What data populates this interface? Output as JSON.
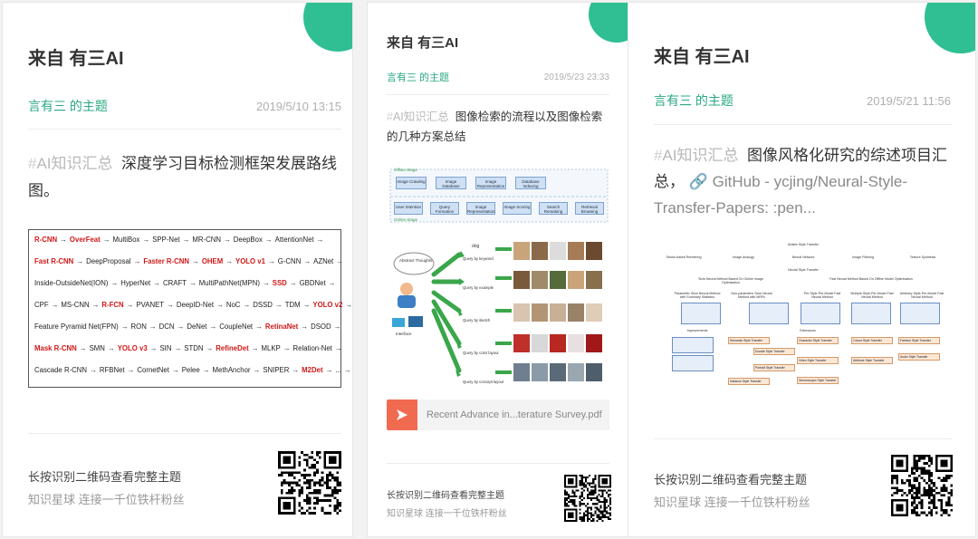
{
  "cards": [
    {
      "from": "来自 有三AI",
      "topic": "言有三 的主题",
      "time": "2019/5/10 13:15",
      "tag": "AI知识汇总",
      "text": "深度学习目标检测框架发展路线图。",
      "footer_line1": "长按识别二维码查看完整主题",
      "footer_line2": "知识星球  连接一千位铁杆粉丝"
    },
    {
      "from": "来自 有三AI",
      "topic": "言有三 的主题",
      "time": "2019/5/23 23:33",
      "tag": "AI知识汇总",
      "text": "图像检索的流程以及图像检索的几种方案总结",
      "attachment": "Recent Advance in...terature Survey.pdf",
      "footer_line1": "长按识别二维码查看完整主题",
      "footer_line2": "知识星球  连接一千位铁杆粉丝"
    },
    {
      "from": "来自 有三AI",
      "topic": "言有三 的主题",
      "time": "2019/5/21 11:56",
      "tag": "AI知识汇总",
      "text": "图像风格化研究的综述项目汇总，",
      "link_text": "GitHub - ycjing/Neural-Style-Transfer-Papers: :pen...",
      "footer_line1": "长按识别二维码查看完整主题",
      "footer_line2": "知识星球  连接一千位铁杆粉丝"
    }
  ],
  "detection_roadmap": {
    "rows": [
      [
        {
          "t": "R-CNN",
          "r": true
        },
        {
          "t": "OverFeat",
          "r": true
        },
        {
          "t": "MultiBox"
        },
        {
          "t": "SPP-Net"
        },
        {
          "t": "MR-CNN"
        },
        {
          "t": "DeepBox"
        },
        {
          "t": "AttentionNet"
        }
      ],
      [
        {
          "t": "Fast R-CNN",
          "r": true
        },
        {
          "t": "DeepProposal"
        },
        {
          "t": "Faster R-CNN",
          "r": true
        },
        {
          "t": "OHEM",
          "r": true
        },
        {
          "t": "YOLO v1",
          "r": true
        },
        {
          "t": "G-CNN"
        },
        {
          "t": "AZNet"
        }
      ],
      [
        {
          "t": "Inside-OutsideNet(ION)"
        },
        {
          "t": "HyperNet"
        },
        {
          "t": "CRAFT"
        },
        {
          "t": "MultiPathNet(MPN)"
        },
        {
          "t": "SSD",
          "r": true
        },
        {
          "t": "GBDNet"
        }
      ],
      [
        {
          "t": "CPF"
        },
        {
          "t": "MS-CNN"
        },
        {
          "t": "R-FCN",
          "r": true
        },
        {
          "t": "PVANET"
        },
        {
          "t": "DeepID-Net"
        },
        {
          "t": "NoC"
        },
        {
          "t": "DSSD"
        },
        {
          "t": "TDM"
        },
        {
          "t": "YOLO v2",
          "r": true
        }
      ],
      [
        {
          "t": "Feature Pyramid Net(FPN)"
        },
        {
          "t": "RON"
        },
        {
          "t": "DCN"
        },
        {
          "t": "DeNet"
        },
        {
          "t": "CoupleNet"
        },
        {
          "t": "RetinaNet",
          "r": true
        },
        {
          "t": "DSOD"
        }
      ],
      [
        {
          "t": "Mask R-CNN",
          "r": true
        },
        {
          "t": "SMN"
        },
        {
          "t": "YOLO v3",
          "r": true
        },
        {
          "t": "SIN"
        },
        {
          "t": "STDN"
        },
        {
          "t": "RefineDet",
          "r": true
        },
        {
          "t": "MLKP"
        },
        {
          "t": "Relation-Net"
        }
      ],
      [
        {
          "t": "Cascade R-CNN"
        },
        {
          "t": "RFBNet"
        },
        {
          "t": "CornetNet"
        },
        {
          "t": "Pelee"
        },
        {
          "t": "MethAnchor"
        },
        {
          "t": "SNIPER"
        },
        {
          "t": "M2Det",
          "r": true
        },
        {
          "t": "..."
        }
      ]
    ]
  },
  "retrieval_flow": {
    "offline_label": "Offline Stage",
    "online_label": "Online Stage",
    "offline_boxes": [
      "Image Crawling",
      "Image Database",
      "Image Representation",
      "Database Indexing"
    ],
    "online_boxes": [
      "User Intention",
      "Query Formation",
      "Image Representation",
      "Image Scoring",
      "Search Reranking",
      "Retrieval Browsing"
    ],
    "thought_label": "Abstract Thoughts",
    "interface_label": "Interface",
    "query_keyword_tag": "dog",
    "query_labels": [
      "Query by keyword",
      "Query by example",
      "Query by sketch",
      "Query by color layout",
      "Query by concept layout"
    ]
  },
  "style_tree": {
    "root": "Artistic Style Transfer",
    "top_categories": [
      "Stroke-based Rendering",
      "Image Analogy",
      "Neural Network",
      "Image Filtering",
      "Texture Synthesis"
    ],
    "nst": "Neural Style Transfer",
    "slow": "Slow Neural Method Based On Online Image Optimisation",
    "fast": "Fast Neural Method Based On Offline Model Optimisation",
    "slow_children": [
      "Parametric Slow Neural Method with Summary Statistics",
      "Non-parametric Slow Neural Method with MRFs"
    ],
    "fast_children": [
      "Per-Style-Per-Model Fast Neural Method",
      "Multiple-Style-Per-Model Fast Neural Method",
      "Arbitrary-Style-Per-Model Fast Neural Method"
    ],
    "improvements": "Improvements",
    "extensions": "Extensions",
    "orange_boxes": [
      "Semantic Style Transfer",
      "Doodle Style Transfer",
      "Portrait Style Transfer",
      "Instance Style Transfer",
      "Character Style Transfer",
      "Video Style Transfer",
      "Stereoscopic Style Transfer",
      "Colour Style Transfer",
      "Attribute Style Transfer",
      "Fashion Style Transfer",
      "Audio Style Transfer"
    ]
  }
}
